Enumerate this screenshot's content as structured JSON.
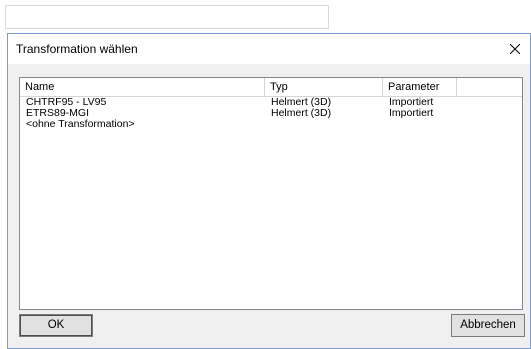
{
  "dialog": {
    "title": "Transformation wählen",
    "close_icon": "close-icon"
  },
  "list": {
    "columns": [
      "Name",
      "Typ",
      "Parameter",
      ""
    ],
    "rows": [
      {
        "name": "CHTRF95 - LV95",
        "typ": "Helmert (3D)",
        "parameter": "Importiert"
      },
      {
        "name": "ETRS89-MGI",
        "typ": "Helmert (3D)",
        "parameter": "Importiert"
      },
      {
        "name": "<ohne Transformation>",
        "typ": "",
        "parameter": ""
      }
    ]
  },
  "buttons": {
    "ok": "OK",
    "cancel": "Abbrechen"
  }
}
